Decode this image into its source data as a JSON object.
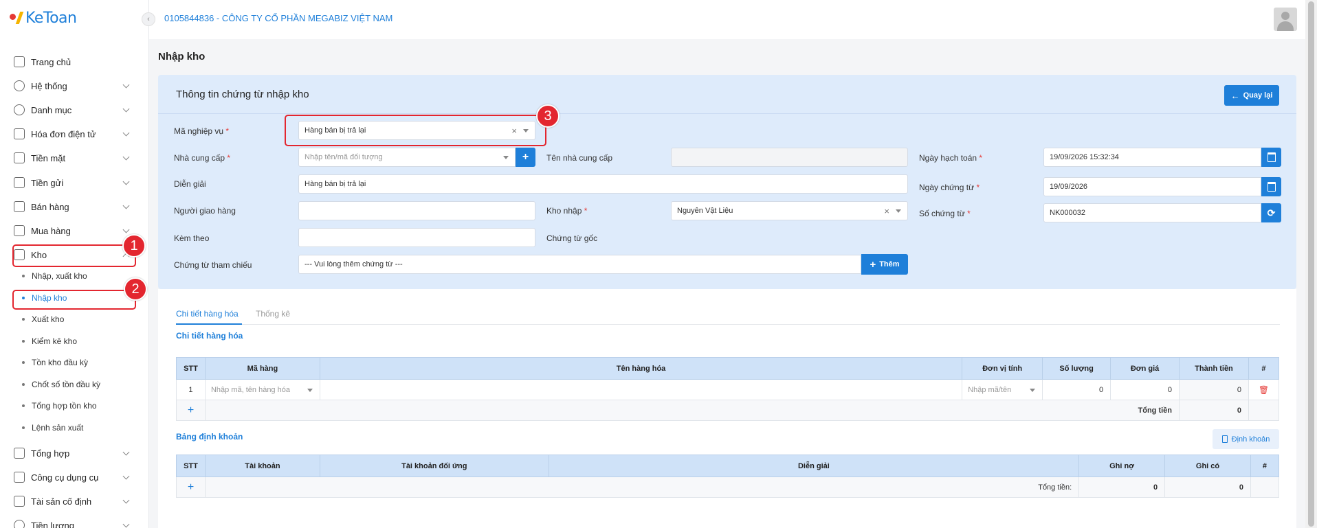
{
  "app": {
    "logo_text": "KeToan",
    "company": "0105844836 - CÔNG TY CỔ PHẦN MEGABIZ VIỆT NAM"
  },
  "sidebar": {
    "items": [
      {
        "label": "Trang chủ",
        "icon": "home-icon"
      },
      {
        "label": "Hệ thống",
        "icon": "gear-icon"
      },
      {
        "label": "Danh mục",
        "icon": "grid-icon"
      },
      {
        "label": "Hóa đơn điện tử",
        "icon": "invoice-icon"
      },
      {
        "label": "Tiền mặt",
        "icon": "cash-icon"
      },
      {
        "label": "Tiền gửi",
        "icon": "card-icon"
      },
      {
        "label": "Bán hàng",
        "icon": "sales-icon"
      },
      {
        "label": "Mua hàng",
        "icon": "cart-icon"
      },
      {
        "label": "Kho",
        "icon": "warehouse-icon"
      },
      {
        "label": "Tổng hợp",
        "icon": "chart-icon"
      },
      {
        "label": "Công cụ dụng cụ",
        "icon": "tool-icon"
      },
      {
        "label": "Tài sản cố định",
        "icon": "car-icon"
      },
      {
        "label": "Tiền lương",
        "icon": "money-icon"
      }
    ],
    "kho_sub": [
      "Nhập, xuất kho",
      "Nhập kho",
      "Xuất kho",
      "Kiểm kê kho",
      "Tồn kho đầu kỳ",
      "Chốt số tồn đầu kỳ",
      "Tổng hợp tồn kho",
      "Lệnh sản xuất"
    ]
  },
  "page": {
    "title": "Nhập kho"
  },
  "form": {
    "title": "Thông tin chứng từ nhập kho",
    "back_label": "Quay lại",
    "labels": {
      "ma_nghiep_vu": "Mã nghiệp vụ",
      "nha_cung_cap": "Nhà cung cấp",
      "ten_nha_cung_cap": "Tên nhà cung cấp",
      "dien_giai": "Diễn giải",
      "nguoi_giao_hang": "Người giao hàng",
      "kho_nhap": "Kho nhập",
      "kem_theo": "Kèm theo",
      "chung_tu_goc": "Chứng từ gốc",
      "chung_tu_tham_chieu": "Chứng từ tham chiếu",
      "ngay_hach_toan": "Ngày hạch toán",
      "ngay_chung_tu": "Ngày chứng từ",
      "so_chung_tu": "Số chứng từ"
    },
    "values": {
      "ma_nghiep_vu": "Hàng bán bị trả lại",
      "nha_cung_cap_placeholder": "Nhập tên/mã đối tượng",
      "dien_giai": "Hàng bán bị trả lại",
      "kho_nhap": "Nguyên Vật Liệu",
      "chung_tu_tham_chieu_placeholder": "--- Vui lòng thêm chứng từ ---",
      "ngay_hach_toan": "19/09/2026 15:32:34",
      "ngay_chung_tu": "19/09/2026",
      "so_chung_tu": "NK000032"
    },
    "add_label": "Thêm",
    "required_mark": "*"
  },
  "tabs": [
    "Chi tiết hàng hóa",
    "Thống kê"
  ],
  "goods": {
    "section_title": "Chi tiết hàng hóa",
    "headers": [
      "STT",
      "Mã hàng",
      "Tên hàng hóa",
      "Đơn vị tính",
      "Số lượng",
      "Đơn giá",
      "Thành tiền",
      "#"
    ],
    "row": {
      "stt": "1",
      "ma_hang_placeholder": "Nhập mã, tên hàng hóa",
      "dvt_placeholder": "Nhập mã/tên",
      "so_luong": "0",
      "don_gia": "0",
      "thanh_tien": "0"
    },
    "total_label": "Tổng tiền",
    "total_value": "0"
  },
  "accounting": {
    "section_title": "Bảng định khoản",
    "button_label": "Định khoản",
    "headers": [
      "STT",
      "Tài khoản",
      "Tài khoản đối ứng",
      "Diễn giải",
      "Ghi nợ",
      "Ghi có",
      "#"
    ],
    "total_label": "Tổng tiền:",
    "total_debit": "0",
    "total_credit": "0"
  },
  "annotations": [
    "1",
    "2",
    "3"
  ],
  "colors": {
    "accent": "#1e7fd9",
    "annotation": "#e3262f",
    "panel": "#deebfb"
  }
}
